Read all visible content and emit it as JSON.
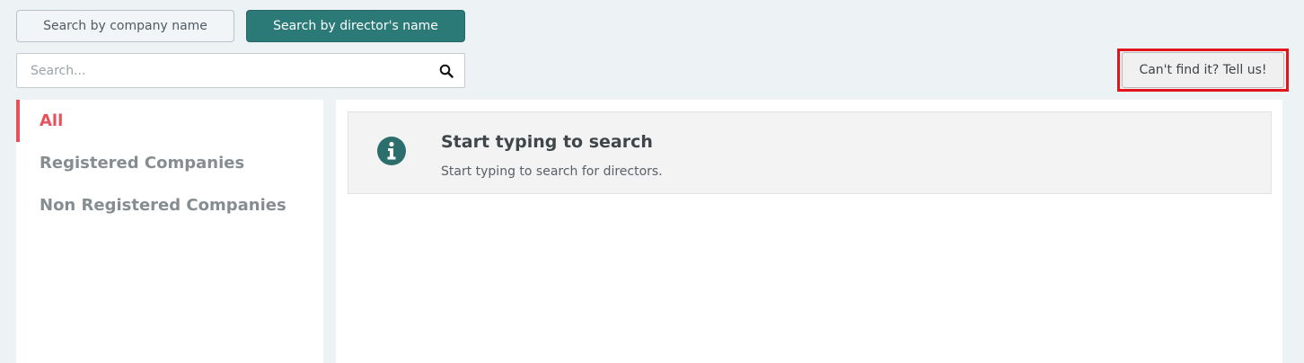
{
  "search_modes": {
    "company_label": "Search by company name",
    "director_label": "Search by director's name",
    "active": "director"
  },
  "search": {
    "placeholder": "Search...",
    "value": ""
  },
  "feedback": {
    "label": "Can't find it? Tell us!",
    "highlight_color": "#e3141b"
  },
  "sidebar": {
    "items": [
      {
        "label": "All",
        "active": true
      },
      {
        "label": "Registered Companies",
        "active": false
      },
      {
        "label": "Non Registered Companies",
        "active": false
      }
    ]
  },
  "notice": {
    "icon": "info-circle-icon",
    "title": "Start typing to search",
    "text": "Start typing to search for directors."
  },
  "colors": {
    "accent": "#2b7a78",
    "active_red": "#e8505b",
    "background": "#edf2f5"
  }
}
